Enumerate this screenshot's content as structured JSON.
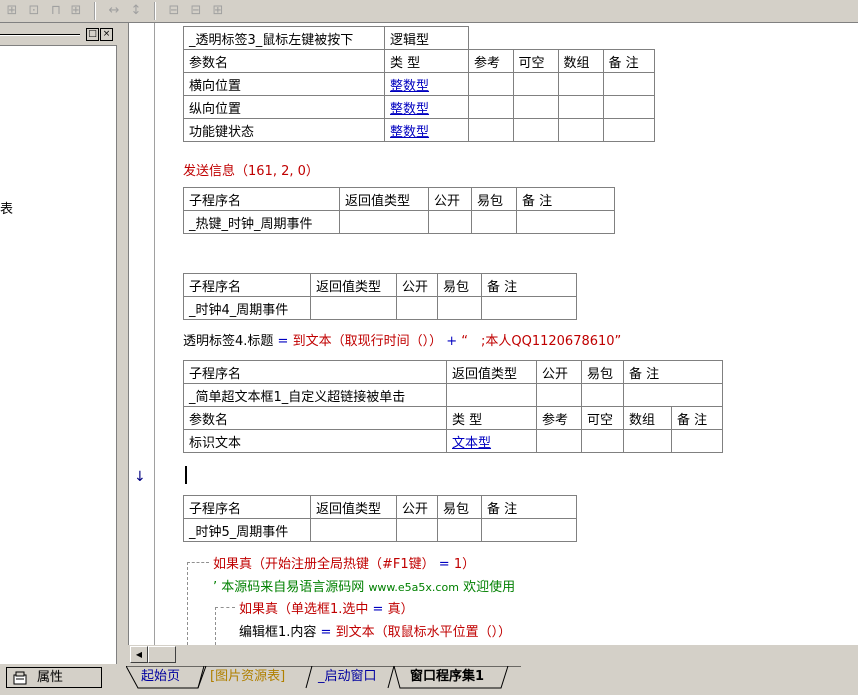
{
  "toolbar": {
    "icons": [
      "align-left-icon",
      "align-center-icon",
      "align-top-icon",
      "align-right-icon",
      "space-horizontal-icon",
      "space-vertical-icon",
      "same-width-icon",
      "same-height-icon",
      "same-size-icon"
    ],
    "glyphs": [
      "⊞",
      "⊡",
      "⊓",
      "⊞",
      "↔",
      "↕",
      "⊟",
      "⊟",
      "⊞"
    ]
  },
  "left_panel": {
    "min_glyph": "□",
    "close_glyph": "×",
    "partial_text": "表"
  },
  "editor": {
    "event1": {
      "name": "_透明标签3_鼠标左键被按下",
      "ret_type": "逻辑型",
      "param_header": [
        "参数名",
        "类 型",
        "参考",
        "可空",
        "数组",
        "备 注"
      ],
      "params": [
        [
          "横向位置",
          "整数型"
        ],
        [
          "纵向位置",
          "整数型"
        ],
        [
          "功能键状态",
          "整数型"
        ]
      ]
    },
    "code_send": "发送信息（161, 2, 0）",
    "sub_header": [
      "子程序名",
      "返回值类型",
      "公开",
      "易包",
      "备 注"
    ],
    "sub_hotkey": "_热键_时钟_周期事件",
    "sub_clock4": "_时钟4_周期事件",
    "code_title": {
      "lhs": "透明标签4.标题",
      "op": " = ",
      "fn": "到文本（取现行时间（））",
      "plus": " + ",
      "str": "“　;本人QQ1120678610”"
    },
    "event2": {
      "name": "_简单超文本框1_自定义超链接被单击",
      "param_name": "标识文本",
      "param_type": "文本型"
    },
    "arrow": "↓",
    "sub_clock5": "_时钟5_周期事件",
    "code_if1": {
      "kw": "如果真（开始注册全局热键（#F1键）",
      "op": " = ",
      "val": "1）"
    },
    "code_comment": {
      "mark": "’",
      "text": "本源码来自易语言源码网",
      "url": "www.e5a5x.com",
      "welcome": "欢迎使用"
    },
    "code_if2": {
      "kw": "如果真（单选框1.选中",
      "op": " = ",
      "val": "真）"
    },
    "code_assign": {
      "lhs": "编辑框1.内容",
      "op": " = ",
      "fn": "到文本（取鼠标水平位置（））"
    }
  },
  "scrollbar": {
    "left_arrow": "◀"
  },
  "tabs": {
    "properties_label": "属性",
    "items": [
      "起始页",
      "[图片资源表]",
      "_启动窗口",
      "窗口程序集1"
    ]
  },
  "colors": {
    "chrome": "#d4d0c8",
    "code_red": "#c00000",
    "type_blue": "#0000c0",
    "tab_yellow": "#b08000",
    "tab_blue": "#0000a0"
  }
}
